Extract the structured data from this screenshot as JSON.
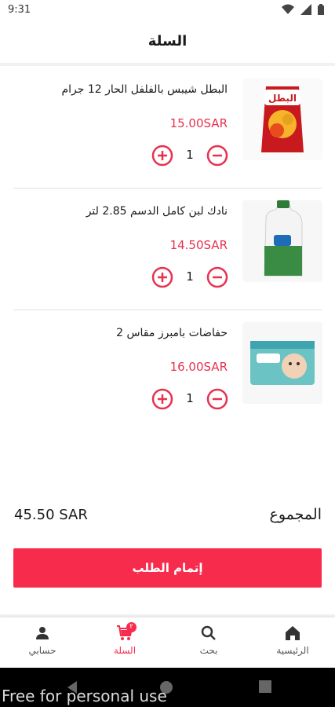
{
  "status_bar": {
    "time": "9:31"
  },
  "header": {
    "title": "السلة"
  },
  "cart": {
    "items": [
      {
        "name": "البطل شيبس بالفلفل الحار 12 جرام",
        "price": "15.00SAR",
        "qty": "1"
      },
      {
        "name": "نادك لبن كامل الدسم 2.85 لتر",
        "price": "14.50SAR",
        "qty": "1"
      },
      {
        "name": "حفاضات بامبرز مقاس 2",
        "price": "16.00SAR",
        "qty": "1"
      }
    ],
    "total_label": "المجموع",
    "total_value": "45.50 SAR",
    "checkout_label": "إتمام الطلب"
  },
  "bottom_nav": {
    "items": [
      {
        "label": "حسابي",
        "icon": "person-icon"
      },
      {
        "label": "السلة",
        "icon": "cart-icon",
        "badge": "٢"
      },
      {
        "label": "بحث",
        "icon": "search-icon"
      },
      {
        "label": "الرئيسية",
        "icon": "home-icon"
      }
    ]
  },
  "watermark": "Free for personal use",
  "colors": {
    "accent": "#f72b4c",
    "price": "#e8314f"
  }
}
